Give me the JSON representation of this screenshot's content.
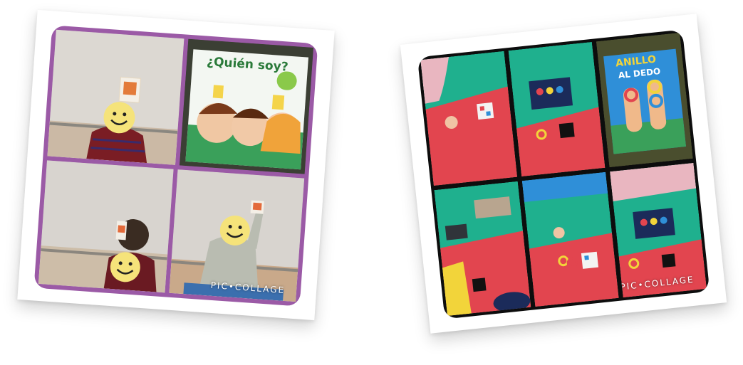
{
  "left_collage": {
    "watermark": "PIC•COLLAGE",
    "game_box_title": "¿Quién soy?"
  },
  "right_collage": {
    "watermark": "PIC•COLLAGE",
    "game_box_title_line1": "ANILLO",
    "game_box_title_line2": "AL DEDO"
  },
  "colors": {
    "left_frame": "#9b5aa6",
    "right_frame": "#0d0d0d",
    "smiley": "#f5e37a",
    "mat_red": "#e2454f",
    "mat_green": "#1fb08e",
    "mat_blue": "#2f8fd8",
    "mat_yellow": "#f2d43a"
  }
}
